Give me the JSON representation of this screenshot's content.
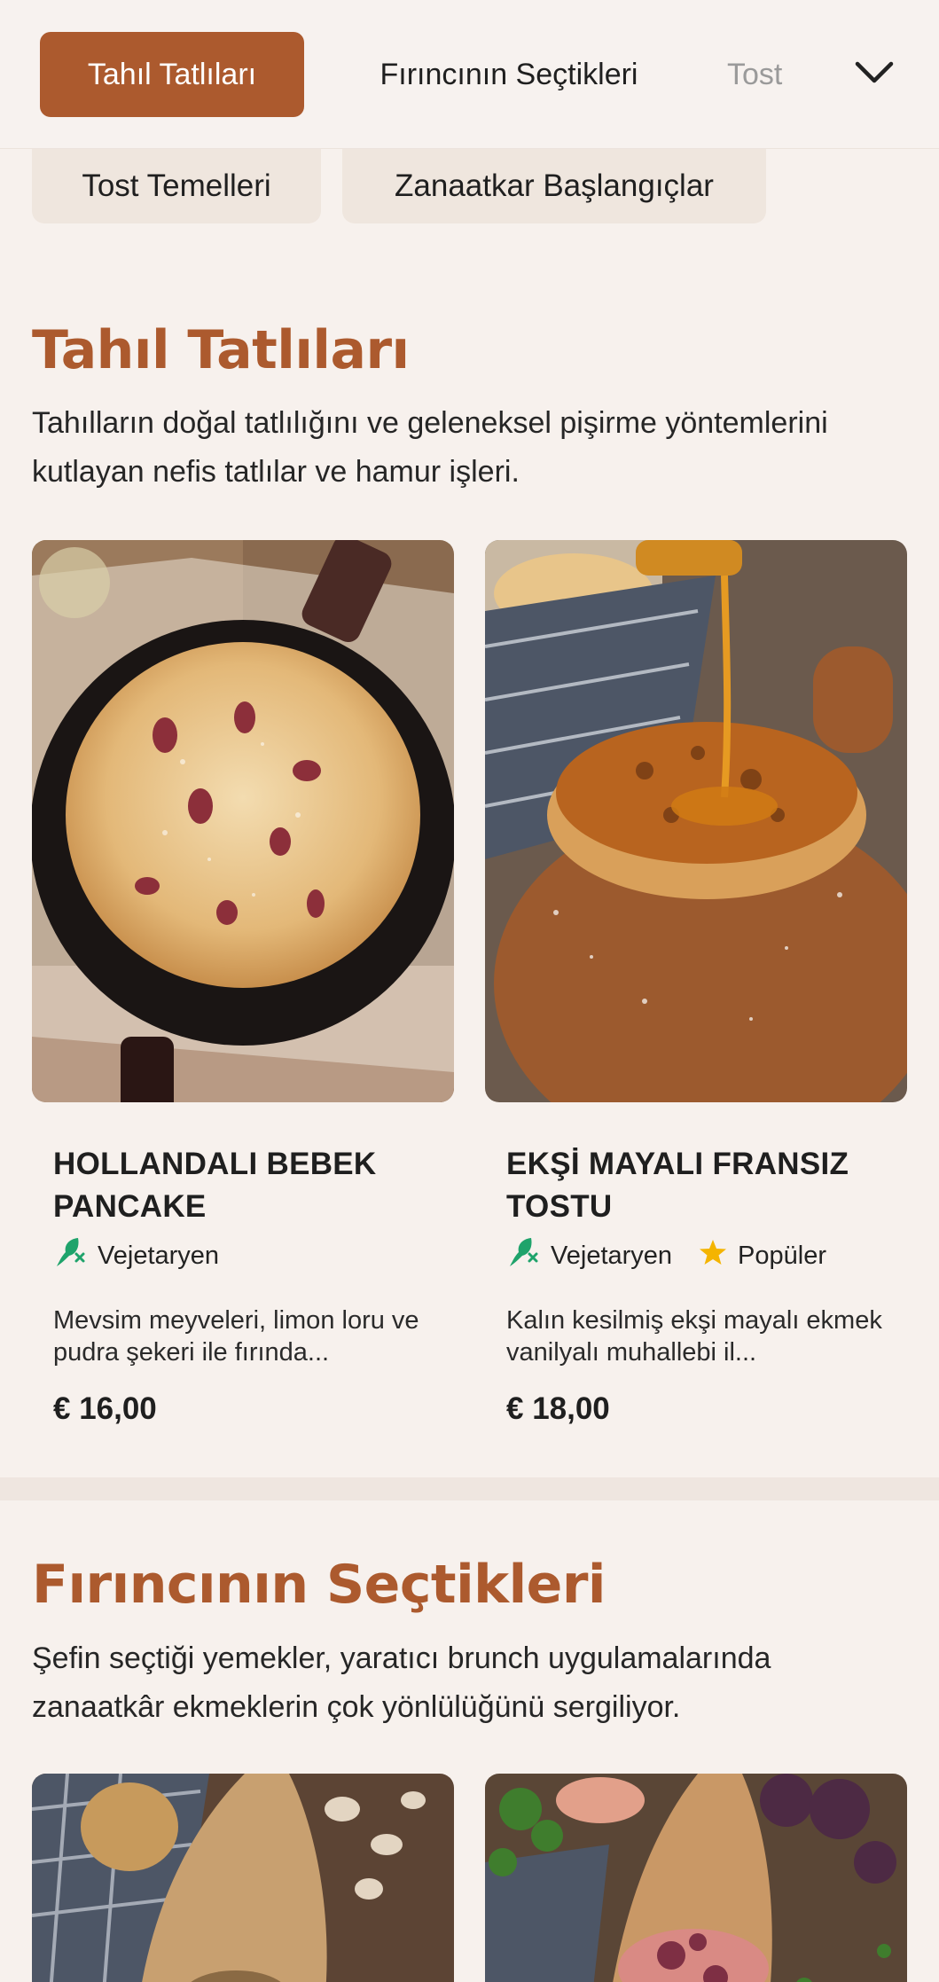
{
  "category_nav": {
    "tabs": [
      {
        "label": "Tahıl Tatlıları",
        "active": true
      },
      {
        "label": "Fırıncının Seçtikleri",
        "active": false
      },
      {
        "label": "Tost",
        "active": false
      }
    ],
    "expand_icon": "chevron-down-icon",
    "chips": [
      {
        "label": "Tost Temelleri"
      },
      {
        "label": "Zanaatkar Başlangıçlar"
      }
    ]
  },
  "sections": [
    {
      "title": "Tahıl Tatlıları",
      "description": "Tahılların doğal tatlılığını ve geleneksel pişirme yöntemlerini kutlayan nefis tatlılar ve hamur işleri.",
      "items": [
        {
          "name": "HOLLANDALI BEBEK PANCAKE",
          "tags": [
            {
              "label": "Vejetaryen",
              "icon": "vegetarian-icon"
            }
          ],
          "description": "Mevsim meyveleri, limon loru ve pudra şekeri ile fırında...",
          "price": "€ 16,00"
        },
        {
          "name": "EKŞİ MAYALI FRANSIZ TOSTU",
          "tags": [
            {
              "label": "Vejetaryen",
              "icon": "vegetarian-icon"
            },
            {
              "label": "Popüler",
              "icon": "star-icon"
            }
          ],
          "description": "Kalın kesilmiş ekşi mayalı ekmek vanilyalı muhallebi il...",
          "price": "€ 18,00"
        }
      ]
    },
    {
      "title": "Fırıncının Seçtikleri",
      "description": "Şefin seçtiği yemekler, yaratıcı brunch uygulamalarında zanaatkâr ekmeklerin çok yönlülüğünü sergiliyor."
    }
  ],
  "colors": {
    "accent": "#ac5a2e",
    "background": "#f7f1ed",
    "chip_bg": "#efe6de",
    "vegetarian_green": "#1fa36b",
    "star_yellow": "#f4b400"
  }
}
